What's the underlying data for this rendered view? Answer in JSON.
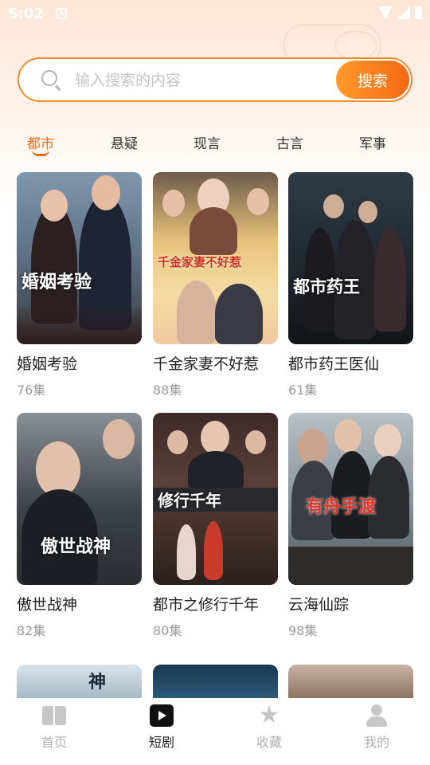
{
  "status_bar": {
    "time": "5:02",
    "notification_glyph": "A"
  },
  "search": {
    "placeholder": "输入搜索的内容",
    "value": "",
    "button_label": "搜索"
  },
  "tabs": [
    {
      "label": "都市",
      "active": true
    },
    {
      "label": "悬疑",
      "active": false
    },
    {
      "label": "现言",
      "active": false
    },
    {
      "label": "古言",
      "active": false
    },
    {
      "label": "军事",
      "active": false
    }
  ],
  "dramas": [
    {
      "title": "婚姻考验",
      "episodes": "76集",
      "poster_text": "婚姻考验"
    },
    {
      "title": "千金家妻不好惹",
      "episodes": "88集",
      "poster_text": "千金家妻不好惹"
    },
    {
      "title": "都市药王医仙",
      "episodes": "61集",
      "poster_text": "都市药王"
    },
    {
      "title": "傲世战神",
      "episodes": "82集",
      "poster_text": "傲世战神"
    },
    {
      "title": "都市之修行千年",
      "episodes": "80集",
      "poster_text": "修行千年"
    },
    {
      "title": "云海仙踪",
      "episodes": "98集",
      "poster_text": "有舟手渡"
    },
    {
      "poster_text": "神"
    },
    {
      "poster_text": ""
    },
    {
      "poster_text": ""
    }
  ],
  "bottom_nav": [
    {
      "label": "首页",
      "icon": "book-icon",
      "active": false
    },
    {
      "label": "短剧",
      "icon": "play-icon",
      "active": true
    },
    {
      "label": "收藏",
      "icon": "star-icon",
      "active": false
    },
    {
      "label": "我的",
      "icon": "user-icon",
      "active": false
    }
  ],
  "colors": {
    "accent": "#f26b16",
    "button_gradient_start": "#ff9a2a",
    "button_gradient_end": "#f46a12"
  }
}
